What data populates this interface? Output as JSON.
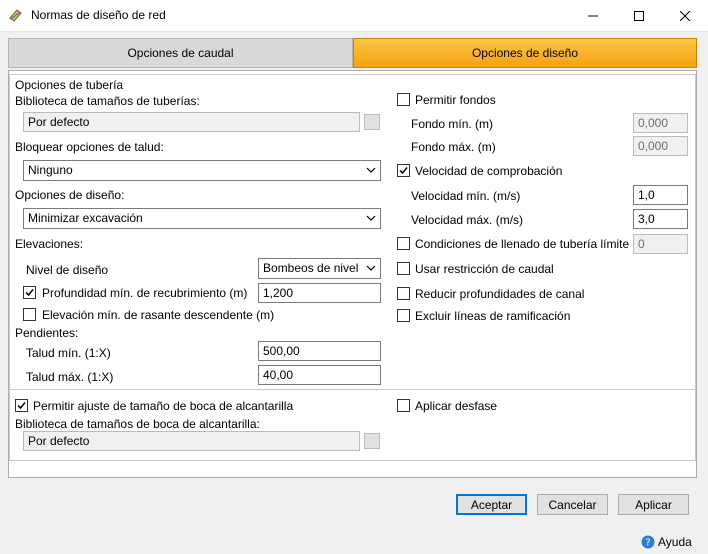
{
  "window": {
    "title": "Normas de diseño de red"
  },
  "tabs": [
    {
      "label": "Opciones de caudal"
    },
    {
      "label": "Opciones de diseño"
    }
  ],
  "left": {
    "pipe_options_heading": "Opciones de tubería",
    "pipe_size_library_label": "Biblioteca de tamaños de tuberías:",
    "pipe_size_library_value": "Por defecto",
    "slope_lock_label": "Bloquear opciones de talud:",
    "slope_lock_value": "Ninguno",
    "design_options_label": "Opciones de diseño:",
    "design_options_value": "Minimizar excavación",
    "elevations_label": "Elevaciones:",
    "design_level_label": "Nivel de diseño",
    "design_level_value": "Bombeos de nivel",
    "min_cover_label": "Profundidad mín. de recubrimiento (m)",
    "min_cover_value": "1,200",
    "min_cover_checked": true,
    "min_drop_label": "Elevación mín. de rasante descendente (m)",
    "min_drop_checked": false,
    "slopes_label": "Pendientes:",
    "min_slope_label": "Talud mín. (1:X)",
    "min_slope_value": "500,00",
    "max_slope_label": "Talud máx. (1:X)",
    "max_slope_value": "40,00"
  },
  "right": {
    "allow_bottoms_label": "Permitir fondos",
    "allow_bottoms_checked": false,
    "min_bottom_label": "Fondo mín. (m)",
    "min_bottom_value": "0,000",
    "max_bottom_label": "Fondo máx. (m)",
    "max_bottom_value": "0,000",
    "check_velocity_label": "Velocidad de comprobación",
    "check_velocity_checked": true,
    "min_velocity_label": "Velocidad mín. (m/s)",
    "min_velocity_value": "1,0",
    "max_velocity_label": "Velocidad máx. (m/s)",
    "max_velocity_value": "3,0",
    "fill_conditions_label": "Condiciones de llenado de tubería límite (%)",
    "fill_conditions_checked": false,
    "fill_conditions_value": "0",
    "flow_restriction_label": "Usar restricción de caudal",
    "flow_restriction_checked": false,
    "reduce_channel_label": "Reducir profundidades de canal",
    "reduce_channel_checked": false,
    "exclude_branch_label": "Excluir líneas de ramificación",
    "exclude_branch_checked": false
  },
  "bottom": {
    "allow_culvert_label": "Permitir ajuste de tamaño de boca de alcantarilla",
    "allow_culvert_checked": true,
    "culvert_library_label": "Biblioteca de tamaños de boca de alcantarilla:",
    "culvert_library_value": "Por defecto",
    "apply_offset_label": "Aplicar desfase",
    "apply_offset_checked": false
  },
  "buttons": {
    "accept": "Aceptar",
    "cancel": "Cancelar",
    "apply": "Aplicar",
    "help": "Ayuda"
  },
  "colors": {
    "active_tab": "#f5a20c",
    "focus_border": "#0078d7"
  }
}
